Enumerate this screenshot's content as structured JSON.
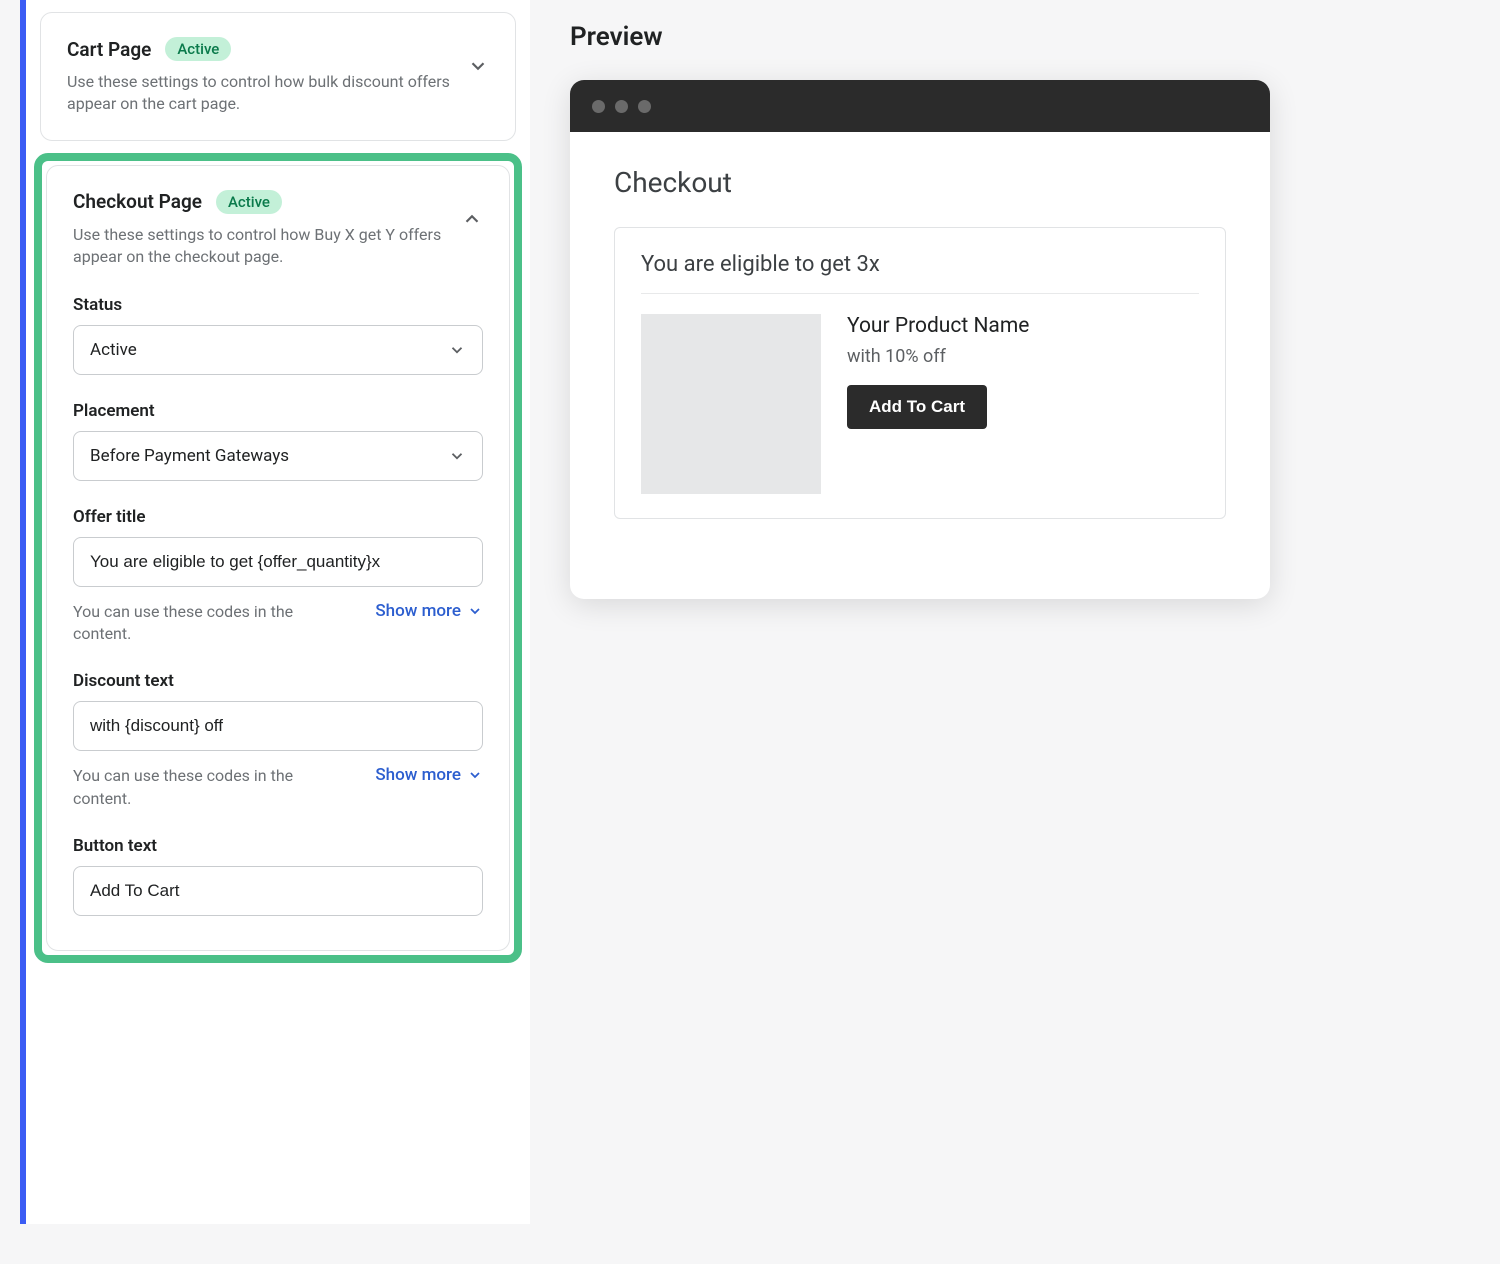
{
  "settings": {
    "cart_page": {
      "title": "Cart Page",
      "badge": "Active",
      "desc": "Use these settings to control how bulk discount offers appear on the cart page."
    },
    "checkout_page": {
      "title": "Checkout Page",
      "badge": "Active",
      "desc": "Use these settings to control how Buy X get Y offers appear on the checkout page.",
      "status_label": "Status",
      "status_value": "Active",
      "placement_label": "Placement",
      "placement_value": "Before Payment Gateways",
      "offer_title_label": "Offer title",
      "offer_title_value": "You are eligible to get {offer_quantity}x",
      "helper_text": "You can use these codes in the content.",
      "show_more": "Show more",
      "discount_text_label": "Discount text",
      "discount_text_value": "with {discount} off",
      "button_text_label": "Button text",
      "button_text_value": "Add To Cart"
    }
  },
  "preview": {
    "title": "Preview",
    "checkout_heading": "Checkout",
    "offer_heading": "You are eligible to get 3x",
    "product_name": "Your Product Name",
    "discount_text": "with 10% off",
    "add_to_cart": "Add To Cart"
  }
}
